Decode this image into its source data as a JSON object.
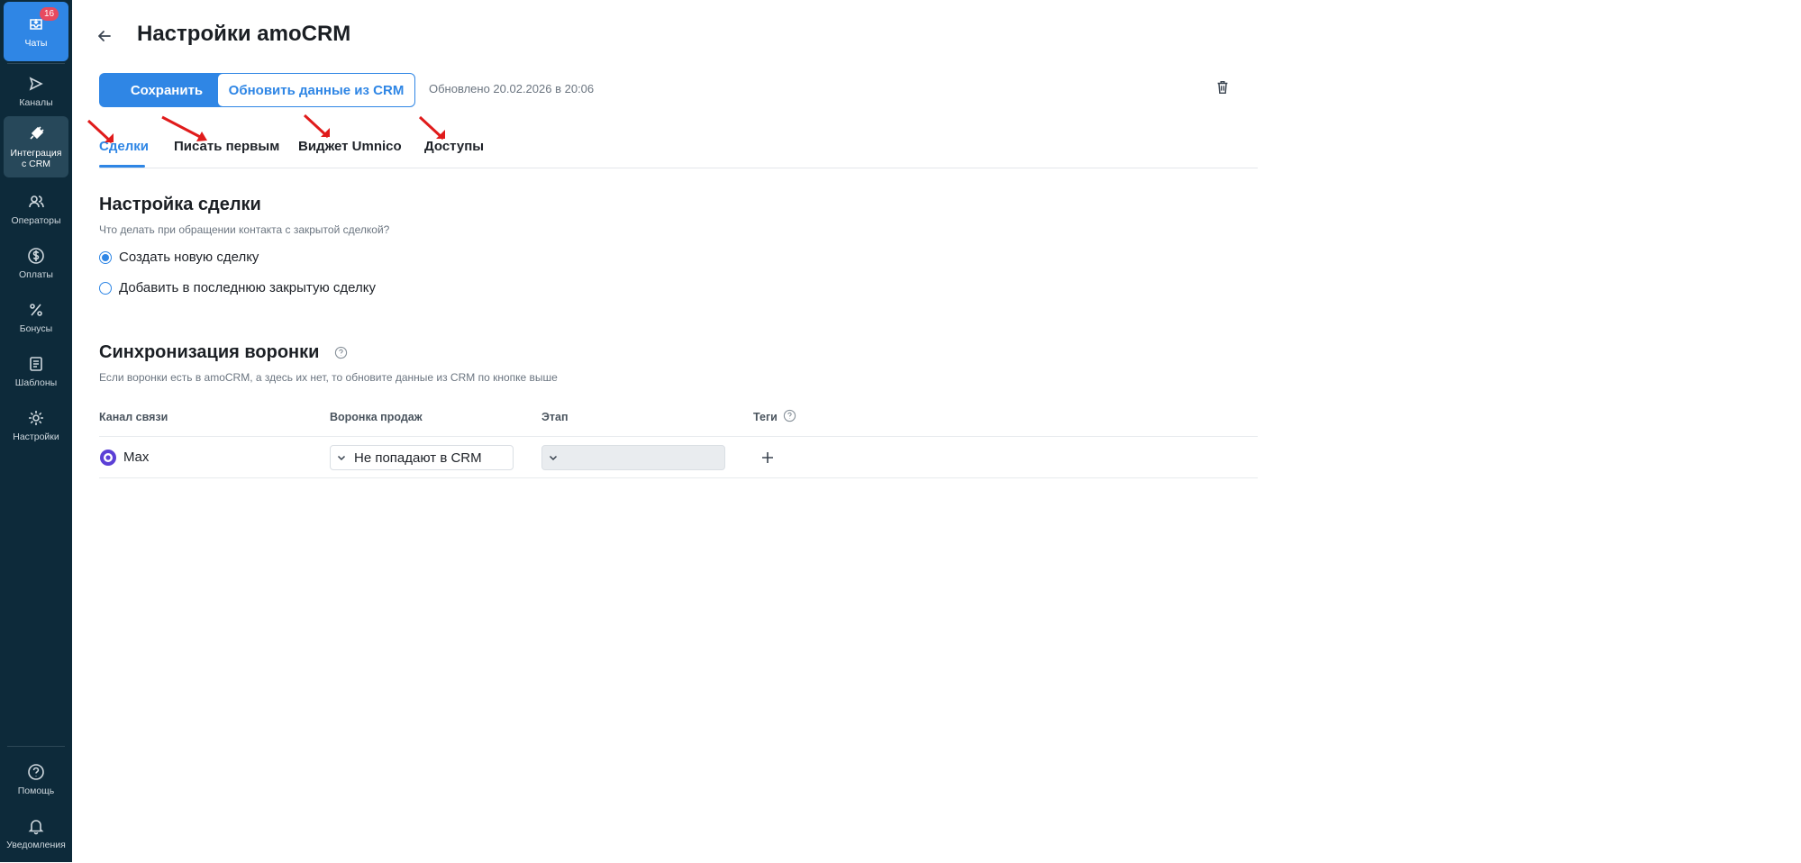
{
  "sidebar": {
    "chats": {
      "label": "Чаты",
      "badge": "16"
    },
    "items": [
      {
        "label": "Каналы",
        "icon": "send-icon"
      },
      {
        "label": "Интеграция с CRM",
        "icon": "plug-icon"
      },
      {
        "label": "Операторы",
        "icon": "users-icon"
      },
      {
        "label": "Оплаты",
        "icon": "dollar-icon"
      },
      {
        "label": "Бонусы",
        "icon": "percent-icon"
      },
      {
        "label": "Шаблоны",
        "icon": "template-icon"
      },
      {
        "label": "Настройки",
        "icon": "gear-icon"
      }
    ],
    "bottom": [
      {
        "label": "Помощь",
        "icon": "help-icon"
      },
      {
        "label": "Уведомления",
        "icon": "bell-icon"
      }
    ]
  },
  "header": {
    "title": "Настройки amoCRM",
    "save_label": "Сохранить",
    "refresh_label": "Обновить данные из CRM",
    "updated_text": "Обновлено 20.02.2026 в 20:06"
  },
  "tabs": [
    {
      "label": "Сделки",
      "active": true
    },
    {
      "label": "Писать первым",
      "active": false
    },
    {
      "label": "Виджет Umnico",
      "active": false
    },
    {
      "label": "Доступы",
      "active": false
    }
  ],
  "deal_settings": {
    "title": "Настройка сделки",
    "question": "Что делать при обращении контакта с закрытой сделкой?",
    "options": [
      {
        "label": "Создать новую сделку",
        "selected": true
      },
      {
        "label": "Добавить в последнюю закрытую сделку",
        "selected": false
      }
    ]
  },
  "funnel_sync": {
    "title": "Синхронизация воронки",
    "description": "Если воронки есть в amoCRM, а здесь их нет, то обновите данные из CRM по кнопке выше",
    "columns": [
      "Канал связи",
      "Воронка продаж",
      "Этап",
      "Теги"
    ],
    "rows": [
      {
        "channel": "Max",
        "funnel": "Не попадают в CRM",
        "stage": ""
      }
    ]
  },
  "colors": {
    "accent": "#2f86e5",
    "sidebar": "#0d2a3a",
    "badge": "#e84a5f",
    "annotation_arrow": "#e01b1b"
  }
}
